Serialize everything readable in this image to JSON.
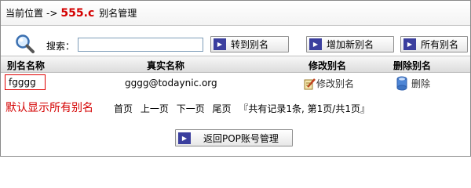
{
  "breadcrumb": {
    "prefix": "当前位置",
    "arrow": "->",
    "domain": "555.c",
    "page": "别名管理"
  },
  "search": {
    "label": "搜索：",
    "value": ""
  },
  "buttons": {
    "goto_alias": "转到别名",
    "add_alias": "增加新别名",
    "all_aliases": "所有别名",
    "back": "返回POP账号管理"
  },
  "table": {
    "headers": [
      "别名名称",
      "真实名称",
      "修改别名",
      "删除别名"
    ],
    "rows": [
      {
        "alias": "fgggg",
        "real": "gggg@todaynic.org",
        "modify": "修改别名",
        "delete": "删除"
      }
    ]
  },
  "note": "默认显示所有别名",
  "pager": {
    "first": "首页",
    "prev": "上一页",
    "next": "下一页",
    "last": "尾页",
    "summary": "『共有记录1条, 第1页/共1页』"
  },
  "icons": {
    "search": "magnifier-icon",
    "button": "arrow-right-icon",
    "modify": "edit-icon",
    "delete": "delete-icon"
  }
}
